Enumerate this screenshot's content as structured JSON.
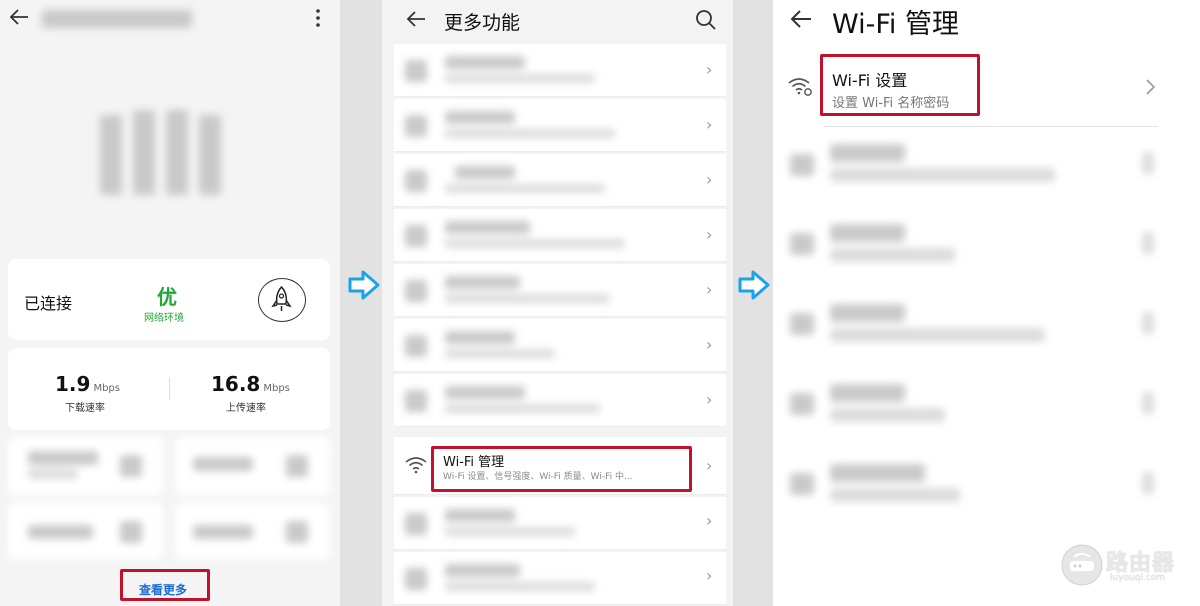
{
  "panel1": {
    "status_label": "已连接",
    "quality_value": "优",
    "quality_label": "网络环境",
    "download_value": "1.9",
    "download_unit": "Mbps",
    "download_label": "下载速率",
    "upload_value": "16.8",
    "upload_unit": "Mbps",
    "upload_label": "上传速率",
    "more_link": "查看更多"
  },
  "panel2": {
    "title": "更多功能",
    "wifi_item_title": "Wi-Fi 管理",
    "wifi_item_subtitle": "Wi-Fi 设置、信号强度、Wi-Fi 质量、Wi-Fi 中..."
  },
  "panel3": {
    "title": "Wi-Fi 管理",
    "wifi_settings_title": "Wi-Fi 设置",
    "wifi_settings_subtitle": "设置 Wi-Fi 名称密码"
  },
  "watermark": {
    "text": "路由器",
    "sub": "luyouqi.com"
  },
  "colors": {
    "highlight": "#c1122b",
    "quality_green": "#22a838",
    "link_blue": "#1a6ed8",
    "arrow_blue": "#1aa3e8"
  }
}
